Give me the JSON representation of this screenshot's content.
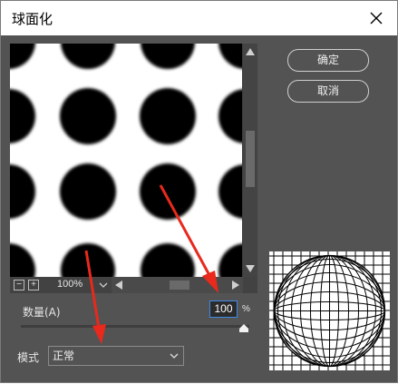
{
  "window": {
    "title": "球面化",
    "close_icon": "close-icon"
  },
  "preview": {
    "zoom_value": "100%",
    "zoom_minus_label": "−",
    "zoom_plus_label": "+"
  },
  "buttons": {
    "ok_label": "确定",
    "cancel_label": "取消"
  },
  "amount": {
    "label": "数量(A)",
    "value": "100",
    "unit": "%",
    "level": 1.0
  },
  "mode": {
    "label": "模式",
    "selected": "正常"
  },
  "colors": {
    "dialog_bg": "#535353",
    "accent": "#3f8be8",
    "arrow": "#e8291c"
  }
}
